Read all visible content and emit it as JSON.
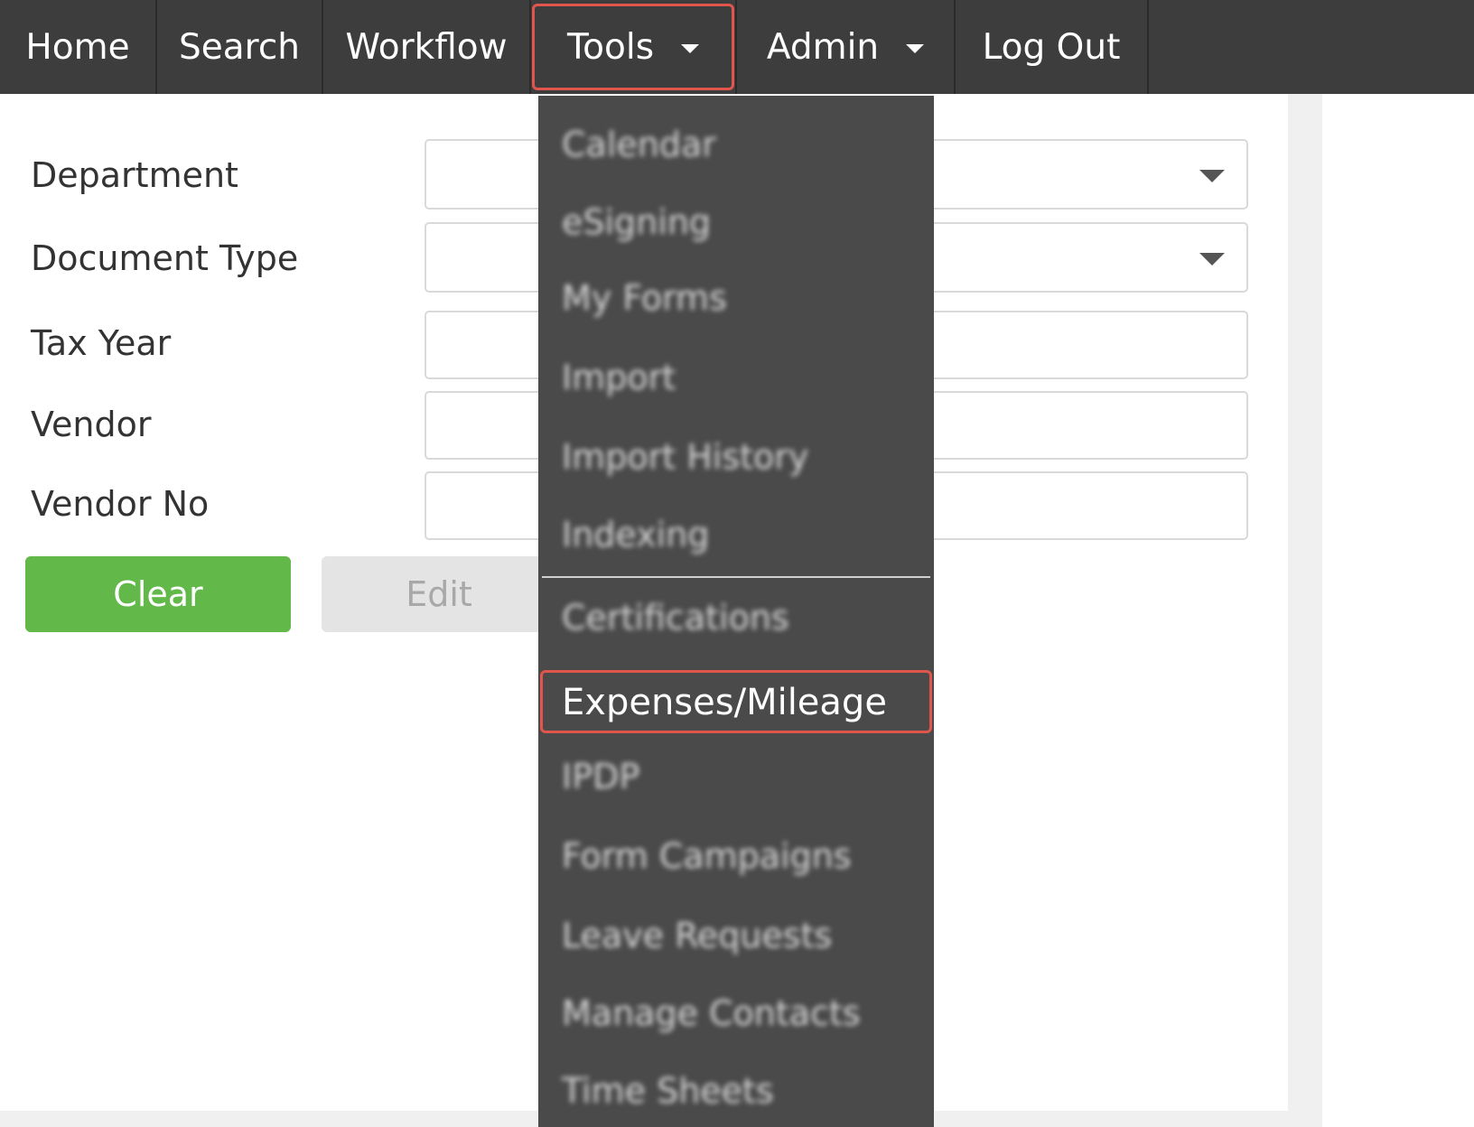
{
  "nav": {
    "home": "Home",
    "search": "Search",
    "workflow": "Workflow",
    "tools": "Tools",
    "admin": "Admin",
    "logout": "Log Out"
  },
  "form": {
    "labels": {
      "department": "Department",
      "document_type": "Document Type",
      "tax_year": "Tax Year",
      "vendor": "Vendor",
      "vendor_no": "Vendor No"
    },
    "values": {
      "department": "",
      "document_type": "",
      "tax_year": "",
      "vendor": "",
      "vendor_no": ""
    }
  },
  "buttons": {
    "clear": "Clear",
    "edit": "Edit"
  },
  "tools_menu": {
    "items": [
      "Calendar",
      "eSigning",
      "My Forms",
      "Import",
      "Import History",
      "Indexing",
      "Certifications",
      "Expenses/Mileage",
      "IPDP",
      "Form Campaigns",
      "Leave Requests",
      "Manage Contacts",
      "Time Sheets"
    ],
    "highlighted": "Expenses/Mileage"
  },
  "colors": {
    "navbar_bg": "#3d3d3d",
    "menu_bg": "#4a4a4a",
    "highlight": "#e0554c",
    "clear_button": "#62b849",
    "edit_button": "#e4e4e4"
  }
}
